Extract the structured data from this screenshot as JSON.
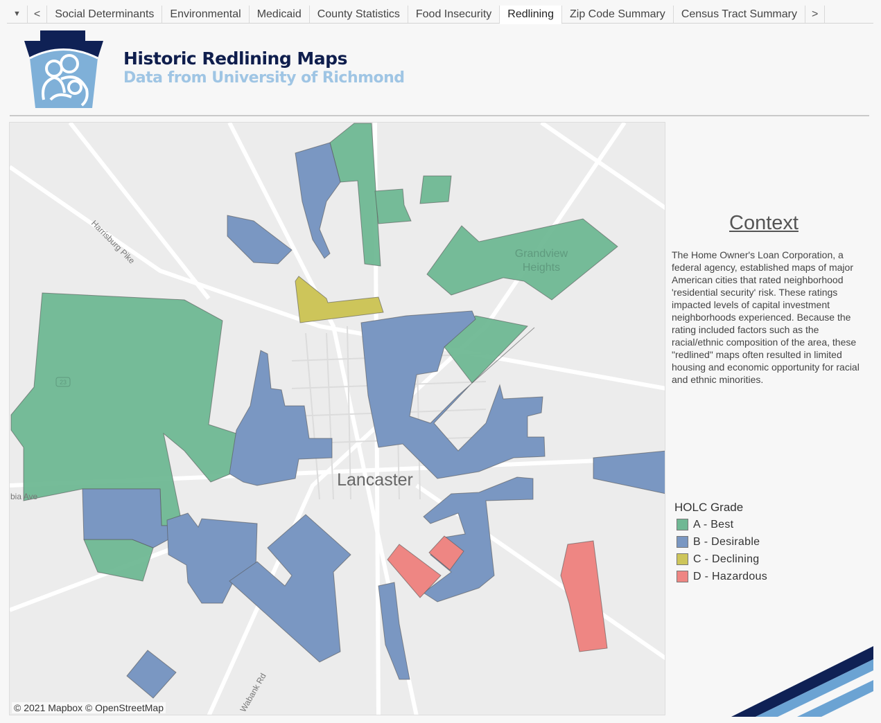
{
  "tabs": {
    "menu_icon": "caret-down-icon",
    "prev_icon": "chevron-left-icon",
    "next_icon": "chevron-right-icon",
    "items": [
      {
        "label": "Social Determinants"
      },
      {
        "label": "Environmental"
      },
      {
        "label": "Medicaid"
      },
      {
        "label": "County Statistics"
      },
      {
        "label": "Food Insecurity"
      },
      {
        "label": "Redlining",
        "active": true
      },
      {
        "label": "Zip Code Summary"
      },
      {
        "label": "Census Tract Summary"
      }
    ]
  },
  "header": {
    "title": "Historic Redlining Maps",
    "subtitle": "Data from University of Richmond"
  },
  "map": {
    "city_label": "Lancaster",
    "neighborhood_label": "Grandview Heights",
    "road_labels": [
      "Harrisburg Pike",
      "Wabank Rd",
      "bia Ave",
      "23"
    ],
    "attribution": "© 2021 Mapbox  © OpenStreetMap"
  },
  "context": {
    "title": "Context",
    "body": "The Home Owner's Loan Corporation, a federal agency, established maps of major American cities that rated neighborhood 'residential security' risk. These ratings impacted levels of capital investment neighborhoods experienced. Because the rating included factors such as the racial/ethnic composition of the area, these \"redlined\" maps often resulted in limited housing and economic opportunity for racial and ethnic minorities."
  },
  "legend": {
    "title": "HOLC Grade",
    "items": [
      {
        "label": "A - Best",
        "color": "#6fb894"
      },
      {
        "label": "B - Desirable",
        "color": "#7a97c2"
      },
      {
        "label": "C - Declining",
        "color": "#cdc55a"
      },
      {
        "label": "D - Hazardous",
        "color": "#ee8683"
      }
    ]
  },
  "colors": {
    "navy": "#0f1e4d",
    "light_blue": "#6ba3d3"
  }
}
